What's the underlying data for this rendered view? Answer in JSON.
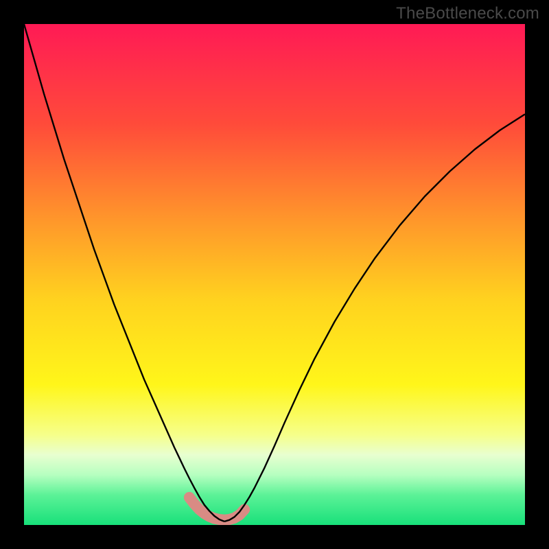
{
  "attribution": "TheBottleneck.com",
  "chart_data": {
    "type": "line",
    "title": "",
    "xlabel": "",
    "ylabel": "",
    "xlim": [
      0,
      100
    ],
    "ylim": [
      0,
      100
    ],
    "grid": false,
    "legend": false,
    "background_gradient_stops": [
      {
        "offset": 0.0,
        "color": "#ff1a55"
      },
      {
        "offset": 0.2,
        "color": "#ff4b3a"
      },
      {
        "offset": 0.4,
        "color": "#ff9a2a"
      },
      {
        "offset": 0.55,
        "color": "#ffd21f"
      },
      {
        "offset": 0.72,
        "color": "#fff61a"
      },
      {
        "offset": 0.82,
        "color": "#f6ff8a"
      },
      {
        "offset": 0.86,
        "color": "#e8ffd0"
      },
      {
        "offset": 0.9,
        "color": "#b6ffc0"
      },
      {
        "offset": 0.94,
        "color": "#5cf297"
      },
      {
        "offset": 1.0,
        "color": "#18e07a"
      }
    ],
    "series": [
      {
        "name": "left-curve",
        "color": "#000000",
        "width": 2.4,
        "x": [
          0,
          2,
          4,
          6,
          8,
          10,
          12,
          14,
          16,
          18,
          20,
          22,
          24,
          26,
          28,
          30,
          31,
          32,
          33,
          34,
          35,
          36,
          37,
          38,
          39,
          40
        ],
        "y": [
          100,
          93,
          86,
          79.5,
          73,
          67,
          61,
          55,
          49.5,
          44,
          39,
          34,
          29,
          24.5,
          20,
          15.5,
          13.4,
          11.3,
          9.3,
          7.4,
          5.6,
          4.0,
          2.8,
          1.8,
          1.1,
          0.7
        ]
      },
      {
        "name": "right-curve",
        "color": "#000000",
        "width": 2.4,
        "x": [
          40,
          41,
          42,
          43,
          44,
          45,
          46,
          48,
          50,
          52,
          55,
          58,
          62,
          66,
          70,
          75,
          80,
          85,
          90,
          95,
          100
        ],
        "y": [
          0.7,
          1.0,
          1.6,
          2.6,
          4.0,
          5.6,
          7.4,
          11.4,
          15.8,
          20.4,
          27.0,
          33.2,
          40.6,
          47.2,
          53.2,
          59.8,
          65.6,
          70.6,
          75.0,
          78.8,
          82.0
        ]
      },
      {
        "name": "highlight-band",
        "color": "#d98b84",
        "width": 16,
        "linecap": "round",
        "x": [
          33.0,
          34.0,
          35.0,
          36.0,
          37.0,
          38.0,
          39.0,
          40.0,
          41.0,
          42.0,
          43.0,
          44.0
        ],
        "y": [
          5.5,
          4.2,
          3.1,
          2.3,
          1.7,
          1.3,
          1.1,
          1.0,
          1.1,
          1.4,
          2.0,
          3.1
        ]
      }
    ]
  }
}
